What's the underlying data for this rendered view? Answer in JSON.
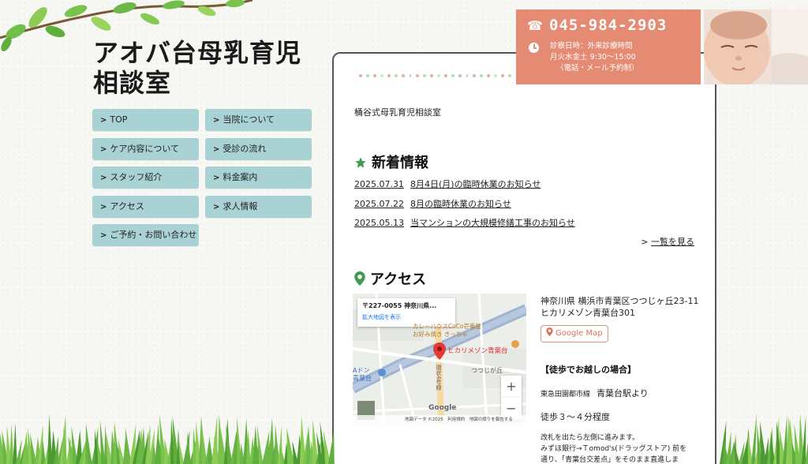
{
  "site": {
    "title_line1": "アオバ台母乳育児",
    "title_line2": "相談室"
  },
  "nav": {
    "items": [
      {
        "label": "TOP"
      },
      {
        "label": "当院について"
      },
      {
        "label": "ケア内容について"
      },
      {
        "label": "受診の流れ"
      },
      {
        "label": "スタッフ紹介"
      },
      {
        "label": "料金案内"
      },
      {
        "label": "アクセス"
      },
      {
        "label": "求人情報"
      },
      {
        "label": "ご予約・お問い合わせ"
      }
    ]
  },
  "contact": {
    "phone": "045-984-2903",
    "hours_line1": "診察日時：外来診療時間",
    "hours_line2": "月火水金土 9:30〜15:00",
    "hours_line3": "（電話・メール予約制）"
  },
  "main": {
    "intro": "桶谷式母乳育児相談室",
    "news": {
      "title": "新着情報",
      "items": [
        {
          "date": "2025.07.31",
          "text": "8月4日(月)の臨時休業のお知らせ"
        },
        {
          "date": "2025.07.22",
          "text": "8月の臨時休業のお知らせ"
        },
        {
          "date": "2025.05.13",
          "text": "当マンションの大規模修繕工事のお知らせ"
        }
      ],
      "more_label": "一覧を見る"
    },
    "access": {
      "title": "アクセス",
      "address_line1": "神奈川県 横浜市青葉区つつじヶ丘23-11",
      "address_line2": "ヒカリメゾン青葉台301",
      "gmap_label": "Google Map",
      "walk_title": "【徒歩でお越しの場合】",
      "walk_line_small": "東急田園都市線",
      "walk_line_big": "青葉台駅より",
      "walk_minutes": "徒歩３〜４分程度",
      "walk_desc1": "改札を出たら左側に進みます。",
      "walk_desc2": "みずほ銀行→Ｔomod's(ドラッグストア) 前を",
      "walk_desc3": "通り、「青葉台交差点」をそのまま直進しま"
    },
    "map": {
      "popup_address": "〒227-0055 神奈川県...",
      "popup_link": "拡大地図を表示",
      "pin_label": "ヒカリメゾン青葉台",
      "label_area": "つつじが丘",
      "label_road": "環状4号線",
      "label_shop1": "カレーハウスCoCo壱番屋",
      "label_shop2": "お好み焼き きっちゃ",
      "label_left1": "Aドン",
      "label_left2": "青葉台",
      "zoom_in": "+",
      "zoom_out": "−",
      "google_logo": "Google",
      "footer": "地図データ ©2025　利用規約　地図の誤りを報告する"
    }
  },
  "colors": {
    "nav_bg": "#a8d2d4",
    "contact_bg": "#e58a73",
    "icon_green": "#3d9a4e"
  }
}
